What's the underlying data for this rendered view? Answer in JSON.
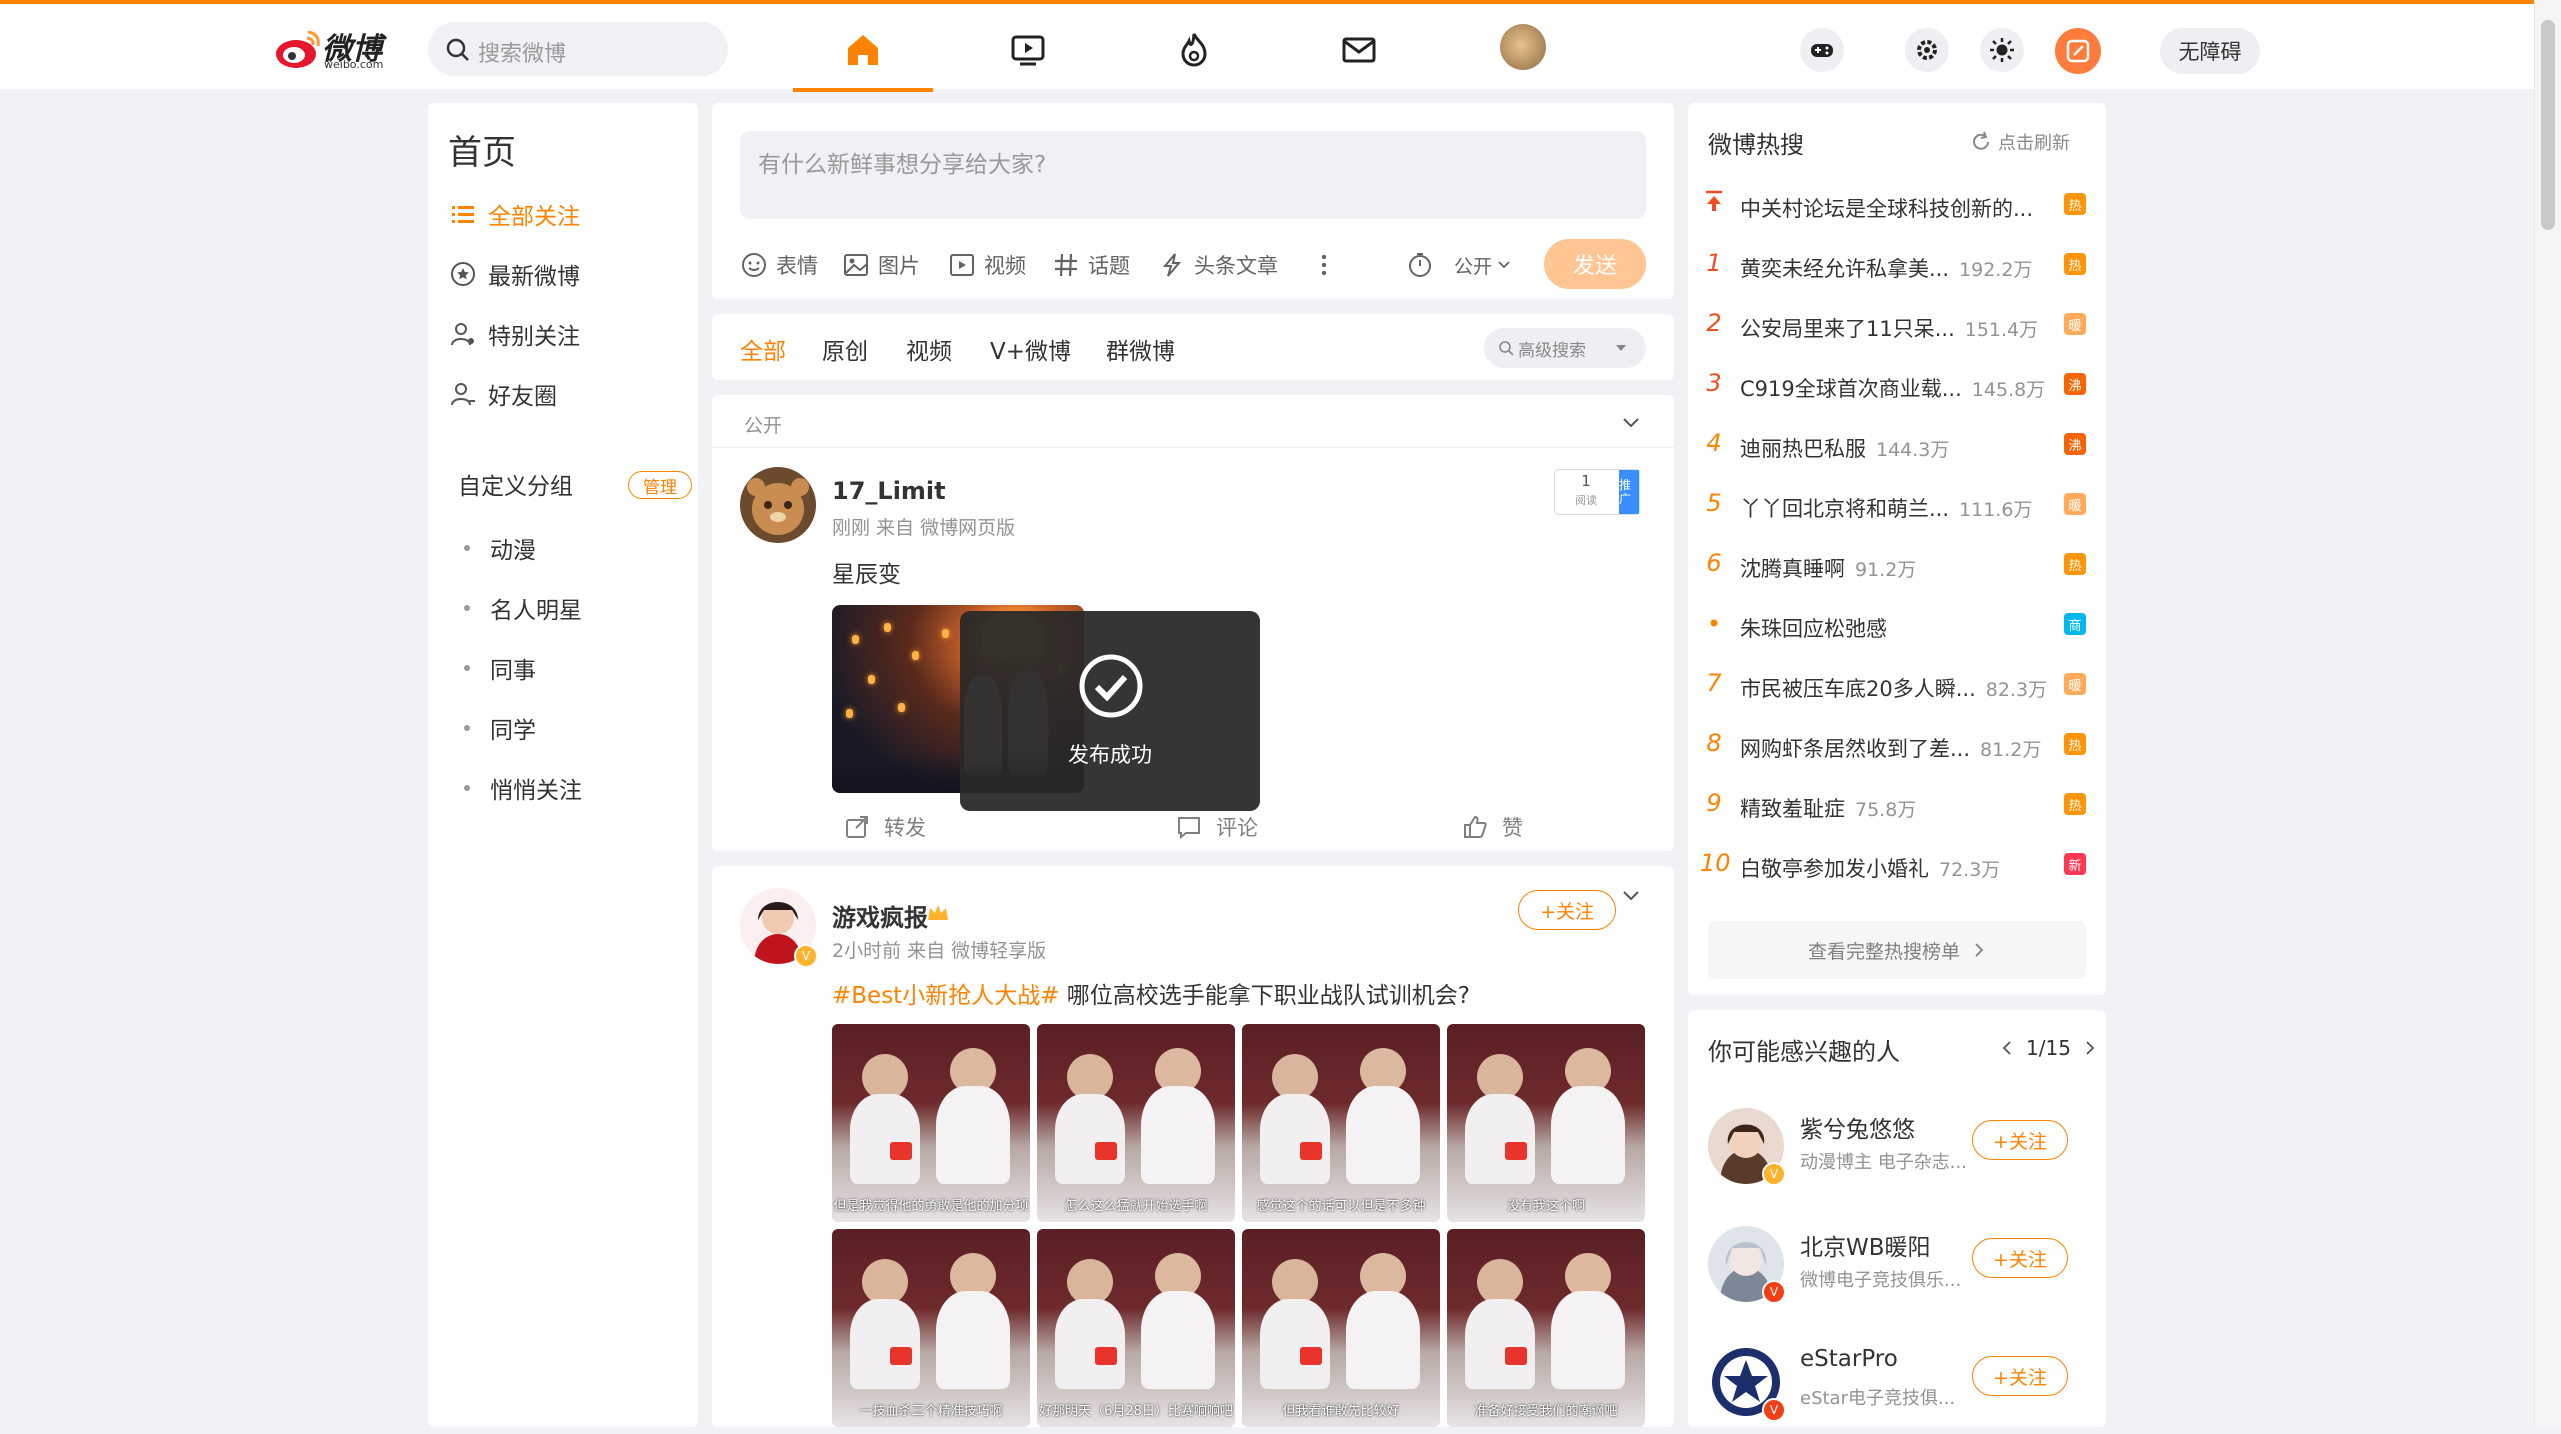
{
  "topbar": {
    "logo_text": "微博",
    "logo_sub": "weibo.com",
    "search_placeholder": "搜索微博",
    "accessibility_label": "无障碍"
  },
  "left_nav": {
    "title": "首页",
    "items": [
      {
        "label": "全部关注",
        "icon": "list-icon",
        "active": true
      },
      {
        "label": "最新微博",
        "icon": "star-circle-icon",
        "active": false
      },
      {
        "label": "特别关注",
        "icon": "user-star-icon",
        "active": false
      },
      {
        "label": "好友圈",
        "icon": "user-group-icon",
        "active": false
      }
    ],
    "group_title": "自定义分组",
    "group_manage": "管理",
    "groups": [
      "动漫",
      "名人明星",
      "同事",
      "同学",
      "悄悄关注"
    ]
  },
  "composer": {
    "placeholder": "有什么新鲜事想分享给大家?",
    "tools": [
      {
        "label": "表情",
        "icon": "emoji-icon"
      },
      {
        "label": "图片",
        "icon": "image-icon"
      },
      {
        "label": "视频",
        "icon": "video-icon"
      },
      {
        "label": "话题",
        "icon": "hashtag-icon"
      },
      {
        "label": "头条文章",
        "icon": "article-icon"
      }
    ],
    "visibility": "公开",
    "send_label": "发送"
  },
  "feed_tabs": {
    "items": [
      "全部",
      "原创",
      "视频",
      "V+微博",
      "群微博"
    ],
    "active": "全部",
    "advanced_search": "高级搜索"
  },
  "post1": {
    "visibility": "公开",
    "username": "17_Limit",
    "meta": "刚刚 来自 微博网页版",
    "text": "星辰变",
    "read_count": "1",
    "read_label": "阅读",
    "promote_label": "推广",
    "toast": "发布成功",
    "actions": {
      "repost": "转发",
      "comment": "评论",
      "like": "赞"
    }
  },
  "post2": {
    "username": "游戏疯报",
    "meta": "2小时前 来自 微博轻享版",
    "topic": "#Best小新抢人大战#",
    "text": " 哪位高校选手能拿下职业战队试训机会?",
    "follow_label": "+关注",
    "captions": [
      "但是我觉得他的勇敢是他的加分项",
      "怎么这么猛就开始选手啊",
      "感觉这个的话可以但是不多钟",
      "没有我这个啊",
      "一技血杀三个精准技巧啊",
      "好那明天（6月28日）比赛响响吧",
      "但我看谁敢先比较好",
      "准备好接受我们的嘲讽吧"
    ]
  },
  "hot_search": {
    "title": "微博热搜",
    "refresh": "点击刷新",
    "items": [
      {
        "rank": "top",
        "text": "中关村论坛是全球科技创新的...",
        "count": "",
        "tag": "热",
        "tag_color": "#ff9406"
      },
      {
        "rank": "1",
        "text": "黄奕未经允许私拿美...",
        "count": "192.2万",
        "tag": "热",
        "tag_color": "#ff9406"
      },
      {
        "rank": "2",
        "text": "公安局里来了11只呆...",
        "count": "151.4万",
        "tag": "暖",
        "tag_color": "#ffab5a"
      },
      {
        "rank": "3",
        "text": "C919全球首次商业载...",
        "count": "145.8万",
        "tag": "沸",
        "tag_color": "#f86400"
      },
      {
        "rank": "4",
        "text": "迪丽热巴私服",
        "count": "144.3万",
        "tag": "沸",
        "tag_color": "#f86400"
      },
      {
        "rank": "5",
        "text": "丫丫回北京将和萌兰...",
        "count": "111.6万",
        "tag": "暖",
        "tag_color": "#ffab5a"
      },
      {
        "rank": "6",
        "text": "沈腾真睡啊",
        "count": "91.2万",
        "tag": "热",
        "tag_color": "#ff9406"
      },
      {
        "rank": "dot",
        "text": "朱珠回应松弛感",
        "count": "",
        "tag": "商",
        "tag_color": "#00b7ee"
      },
      {
        "rank": "7",
        "text": "市民被压车底20多人瞬...",
        "count": "82.3万",
        "tag": "暖",
        "tag_color": "#ffab5a"
      },
      {
        "rank": "8",
        "text": "网购虾条居然收到了差...",
        "count": "81.2万",
        "tag": "热",
        "tag_color": "#ff9406"
      },
      {
        "rank": "9",
        "text": "精致羞耻症",
        "count": "75.8万",
        "tag": "热",
        "tag_color": "#ff9406"
      },
      {
        "rank": "10",
        "text": "白敬亭参加发小婚礼",
        "count": "72.3万",
        "tag": "新",
        "tag_color": "#ff3852"
      }
    ],
    "more": "查看完整热搜榜单"
  },
  "suggested": {
    "title": "你可能感兴趣的人",
    "pager": "1/15",
    "follow_label": "+关注",
    "people": [
      {
        "name": "紫兮兔悠悠",
        "desc": "动漫博主 电子杂志...",
        "badge": "yellow"
      },
      {
        "name": "北京WB暖阳",
        "desc": "微博电子竞技俱乐...",
        "badge": "red"
      },
      {
        "name": "eStarPro",
        "desc": "eStar电子竞技俱...",
        "badge": "red"
      }
    ]
  },
  "colors": {
    "accent": "#ff8200",
    "send_disabled": "#ffc694",
    "background": "#f1f2f5"
  }
}
